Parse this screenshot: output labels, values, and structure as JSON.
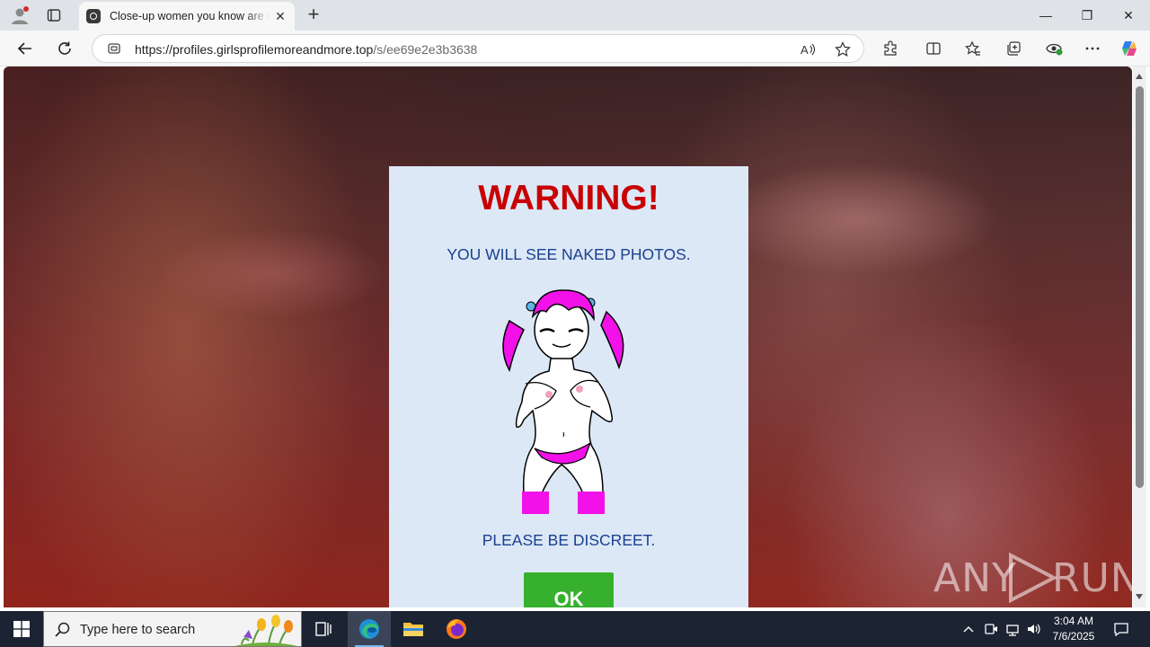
{
  "browser": {
    "tab": {
      "title": "Close-up women you know are lo",
      "close_glyph": "✕"
    },
    "new_tab_glyph": "+",
    "address": {
      "url_host": "https://profiles.girlsprofilemoreandmore.top",
      "url_path": "/s/ee69e2e3b3638"
    },
    "window_controls": {
      "minimize": "—",
      "restore": "❐",
      "close": "✕"
    }
  },
  "page": {
    "modal": {
      "title": "WARNING!",
      "line1": "YOU WILL SEE NAKED PHOTOS.",
      "line2": "PLEASE BE DISCREET.",
      "ok_label": "OK"
    },
    "watermark": {
      "left": "ANY",
      "right": "RUN"
    }
  },
  "taskbar": {
    "search_placeholder": "Type here to search",
    "clock": {
      "time": "3:04 AM",
      "date": "7/6/2025"
    }
  },
  "colors": {
    "warning_red": "#c80000",
    "text_blue": "#1a3f8f",
    "modal_bg": "#dce8f6",
    "ok_green": "#37b12d",
    "taskbar_bg": "#1c2433"
  }
}
